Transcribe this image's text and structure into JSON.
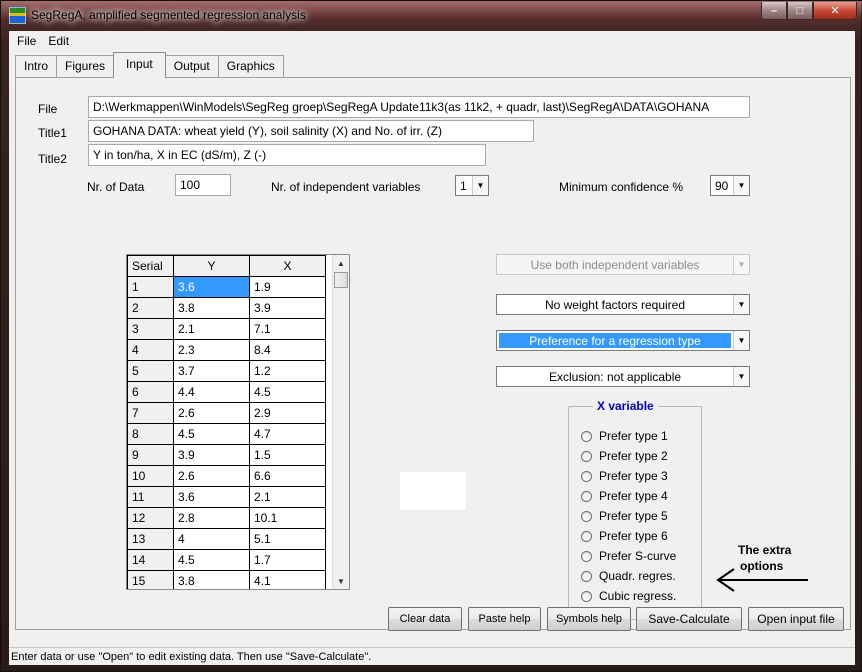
{
  "window": {
    "title": "SegRegA, amplified segmented regression analysis",
    "min_glyph": "–",
    "max_glyph": "□",
    "close_glyph": "✕"
  },
  "menu": [
    "File",
    "Edit"
  ],
  "tabs": [
    "Intro",
    "Figures",
    "Input",
    "Output",
    "Graphics"
  ],
  "active_tab": "Input",
  "form": {
    "file_label": "File",
    "file_value": "D:\\Werkmappen\\WinModels\\SegReg groep\\SegRegA Update11k3(as 11k2, + quadr, last)\\SegRegA\\DATA\\GOHANA",
    "title1_label": "Title1",
    "title1_value": "GOHANA DATA: wheat yield (Y), soil salinity (X) and No. of irr. (Z)",
    "title2_label": "Title2",
    "title2_value": "Y in ton/ha, X in EC (dS/m), Z (-)",
    "nrdata_label": "Nr. of Data",
    "nrdata_value": "100",
    "nrindep_label": "Nr. of independent variables",
    "nrindep_value": "1",
    "minconf_label": "Minimum confidence %",
    "minconf_value": "90"
  },
  "grid": {
    "headers": [
      "Serial",
      "Y",
      "X"
    ],
    "rows": [
      [
        "1",
        "3.6",
        "1.9"
      ],
      [
        "2",
        "3.8",
        "3.9"
      ],
      [
        "3",
        "2.1",
        "7.1"
      ],
      [
        "4",
        "2.3",
        "8.4"
      ],
      [
        "5",
        "3.7",
        "1.2"
      ],
      [
        "6",
        "4.4",
        "4.5"
      ],
      [
        "7",
        "2.6",
        "2.9"
      ],
      [
        "8",
        "4.5",
        "4.7"
      ],
      [
        "9",
        "3.9",
        "1.5"
      ],
      [
        "10",
        "2.6",
        "6.6"
      ],
      [
        "11",
        "3.6",
        "2.1"
      ],
      [
        "12",
        "2.8",
        "10.1"
      ],
      [
        "13",
        "4",
        "5.1"
      ],
      [
        "14",
        "4.5",
        "1.7"
      ],
      [
        "15",
        "3.8",
        "4.1"
      ]
    ]
  },
  "options": {
    "both_vars": "Use both independent variables",
    "weights": "No weight factors required",
    "preference": "Preference for a regression type",
    "exclusion": "Exclusion: not applicable"
  },
  "xvar_group": {
    "title": "X variable",
    "items": [
      "Prefer type 1",
      "Prefer type 2",
      "Prefer type 3",
      "Prefer type 4",
      "Prefer type 5",
      "Prefer type 6",
      "Prefer S-curve",
      "Quadr. regres.",
      "Cubic regress."
    ]
  },
  "note": {
    "line1": "The extra",
    "line2": "options"
  },
  "buttons": {
    "clear": "Clear data",
    "paste_help": "Paste help",
    "symbols_help": "Symbols help",
    "save_calc": "Save-Calculate",
    "open_input": "Open input file"
  },
  "status": "Enter data or use \"Open\" to edit existing data. Then use \"Save-Calculate\"."
}
